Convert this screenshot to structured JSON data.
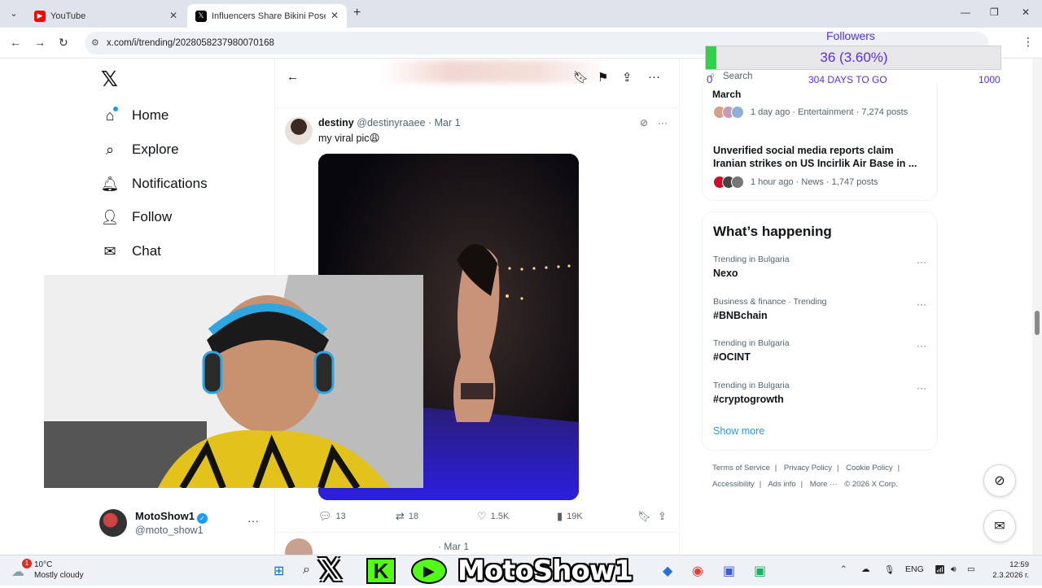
{
  "browser": {
    "tabs": [
      {
        "label": "YouTube"
      },
      {
        "label": "Influencers Share Bikini Poses f"
      }
    ],
    "url": "x.com/i/trending/2028058237980070168"
  },
  "nav": {
    "home": "Home",
    "explore": "Explore",
    "notifications": "Notifications",
    "follow": "Follow",
    "chat": "Chat"
  },
  "profile": {
    "name": "MotoShow1",
    "handle": "@moto_show1"
  },
  "tweet": {
    "name": "destiny",
    "handle": "@destinyraaee",
    "date": "· Mar 1",
    "text": "my viral pic😩",
    "replies": "13",
    "reposts": "18",
    "likes": "1.5K",
    "views": "19K"
  },
  "tweet2": {
    "date": "· Mar 1"
  },
  "followers_overlay": {
    "label": "Followers",
    "value": "36 (3.60%)",
    "progress_percent": 3.6,
    "min": "0",
    "max": "1000",
    "days_left": "304 DAYS TO GO"
  },
  "sidebar": {
    "search_placeholder": "Search",
    "top_item": "March",
    "news": [
      {
        "meta": "1 day ago · Entertainment · 7,274 posts"
      },
      {
        "title": "Unverified social media reports claim Iranian strikes on US Incirlik Air Base in ...",
        "meta": "1 hour ago · News · 1,747 posts"
      }
    ],
    "whats_happening": "What’s happening",
    "trends": [
      {
        "category": "Trending in Bulgaria",
        "name": "Nexo"
      },
      {
        "category": "Business & finance · Trending",
        "name": "#BNBchain"
      },
      {
        "category": "Trending in Bulgaria",
        "name": "#OCINT"
      },
      {
        "category": "Trending in Bulgaria",
        "name": "#cryptogrowth"
      }
    ],
    "show_more": "Show more",
    "footer": [
      "Terms of Service",
      "Privacy Policy",
      "Cookie Policy",
      "Accessibility",
      "Ads info",
      "More ···",
      "© 2026 X Corp."
    ]
  },
  "taskbar": {
    "temp": "10°C",
    "weather": "Mostly cloudy",
    "notif_count": "1",
    "brand_text": "MotoShow1",
    "lang": "ENG",
    "time": "12:59",
    "date": "2.3.2026 г."
  },
  "colors": {
    "accent": "#1d9bf0",
    "overlay_text": "#5a30d6",
    "progress_green": "#2fd34a",
    "kick_green": "#53fc18"
  }
}
